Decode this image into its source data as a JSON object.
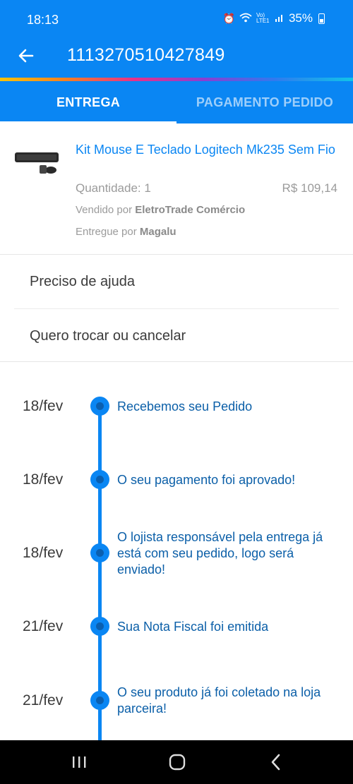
{
  "status_bar": {
    "time": "18:13",
    "network": "Vo) LTE1",
    "battery": "35%"
  },
  "app_bar": {
    "title": "1113270510427849"
  },
  "tabs": [
    {
      "label": "ENTREGA",
      "active": true
    },
    {
      "label": "PAGAMENTO PEDIDO",
      "active": false
    }
  ],
  "product": {
    "name": "Kit Mouse E Teclado Logitech Mk235 Sem Fio",
    "quantity": "Quantidade: 1",
    "price": "R$ 109,14",
    "sold_by_prefix": "Vendido por",
    "sold_by": "EletroTrade Comércio",
    "delivered_by_prefix": "Entregue por",
    "delivered_by": "Magalu"
  },
  "menu": {
    "help": "Preciso de ajuda",
    "change": "Quero trocar ou cancelar"
  },
  "timeline": [
    {
      "date": "18/fev",
      "text": "Recebemos seu Pedido"
    },
    {
      "date": "18/fev",
      "text": "O seu pagamento foi aprovado!"
    },
    {
      "date": "18/fev",
      "text": "O lojista responsável pela entrega já está com seu pedido, logo será enviado!"
    },
    {
      "date": "21/fev",
      "text": "Sua Nota Fiscal foi emitida"
    },
    {
      "date": "21/fev",
      "text": "O seu produto já foi coletado na loja parceira!"
    }
  ],
  "colors": {
    "primary": "#0a86f3",
    "link": "#0b5fa8",
    "muted": "#9b9b9b"
  },
  "icons": [
    "back-arrow-icon",
    "alarm-icon",
    "wifi-icon",
    "signal-icon",
    "battery-icon",
    "recents-icon",
    "home-icon",
    "back-icon"
  ]
}
